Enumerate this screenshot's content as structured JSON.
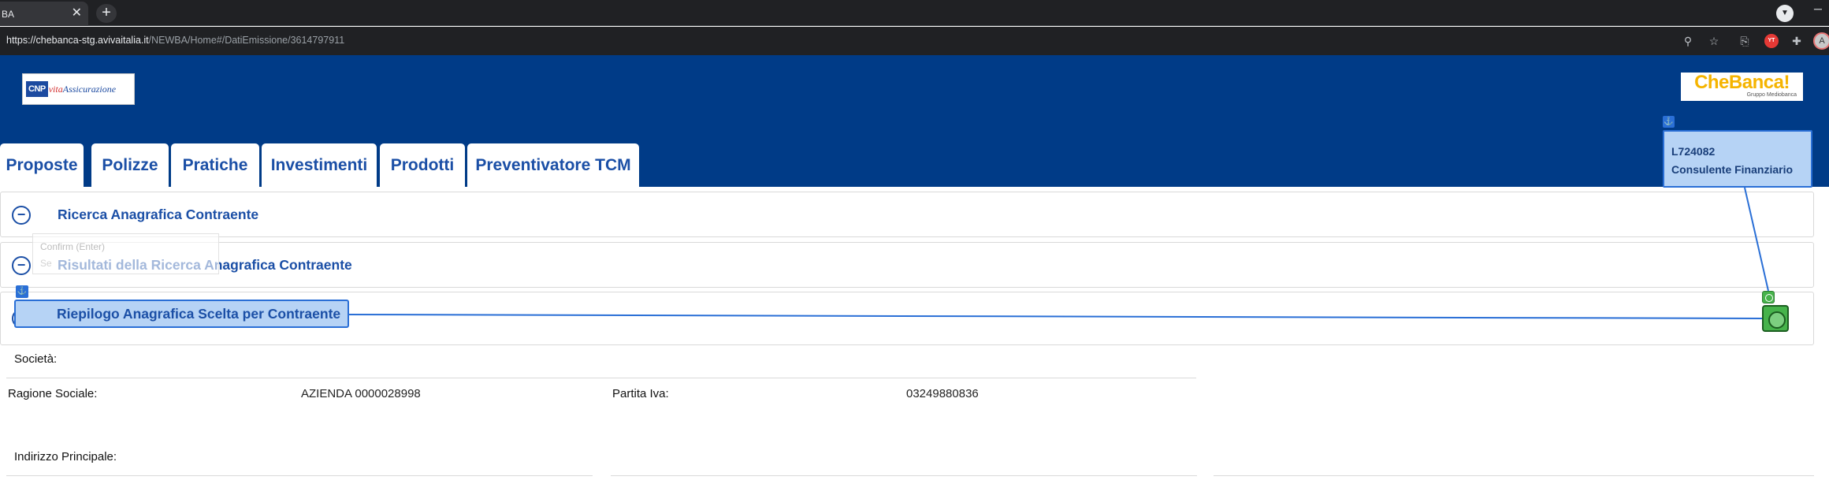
{
  "browser": {
    "tab_title": "BA",
    "tab_close": "✕",
    "new_tab": "+",
    "url_host": "https://chebanca-stg.avivaitalia.it",
    "url_path": "/NEWBA/Home#/DatiEmissione/3614797911",
    "icons": [
      "zoom-icon",
      "star-icon",
      "share-icon",
      "extension-red-icon",
      "puzzle-icon",
      "menu-icon"
    ],
    "profile_initial": "A",
    "ext_badge": "YT"
  },
  "header": {
    "logo_left": {
      "mark": "CNP",
      "vita": "vita",
      "assi": "Assicurazione"
    },
    "logo_right": {
      "main": "CheBanca!",
      "sub": "Gruppo Mediobanca"
    },
    "brand_bg": "#003b87",
    "accent": "#1b4fa6"
  },
  "nav": {
    "tabs": [
      "Proposte",
      "Polizze",
      "Pratiche",
      "Investimenti",
      "Prodotti",
      "Preventivatore TCM"
    ]
  },
  "user": {
    "code": "L724082",
    "role": "Consulente Finanziario"
  },
  "sections": {
    "ricerca": {
      "icon": "−",
      "title": "Ricerca Anagrafica Contraente"
    },
    "risultati": {
      "icon": "−",
      "title": "Risultati della Ricerca Anagrafica Contraente"
    },
    "riepilogo": {
      "icon": "+",
      "title": "Riepilogo Anagrafica Scelta per Contraente"
    }
  },
  "tooltip": {
    "text": "Confirm (Enter)",
    "ghost": "Se"
  },
  "form": {
    "societa_label": "Società:",
    "ragione_label": "Ragione Sociale:",
    "ragione_value": "AZIENDA 0000028998",
    "piva_label": "Partita Iva:",
    "piva_value": "03249880836",
    "indirizzo_label": "Indirizzo Principale:"
  }
}
